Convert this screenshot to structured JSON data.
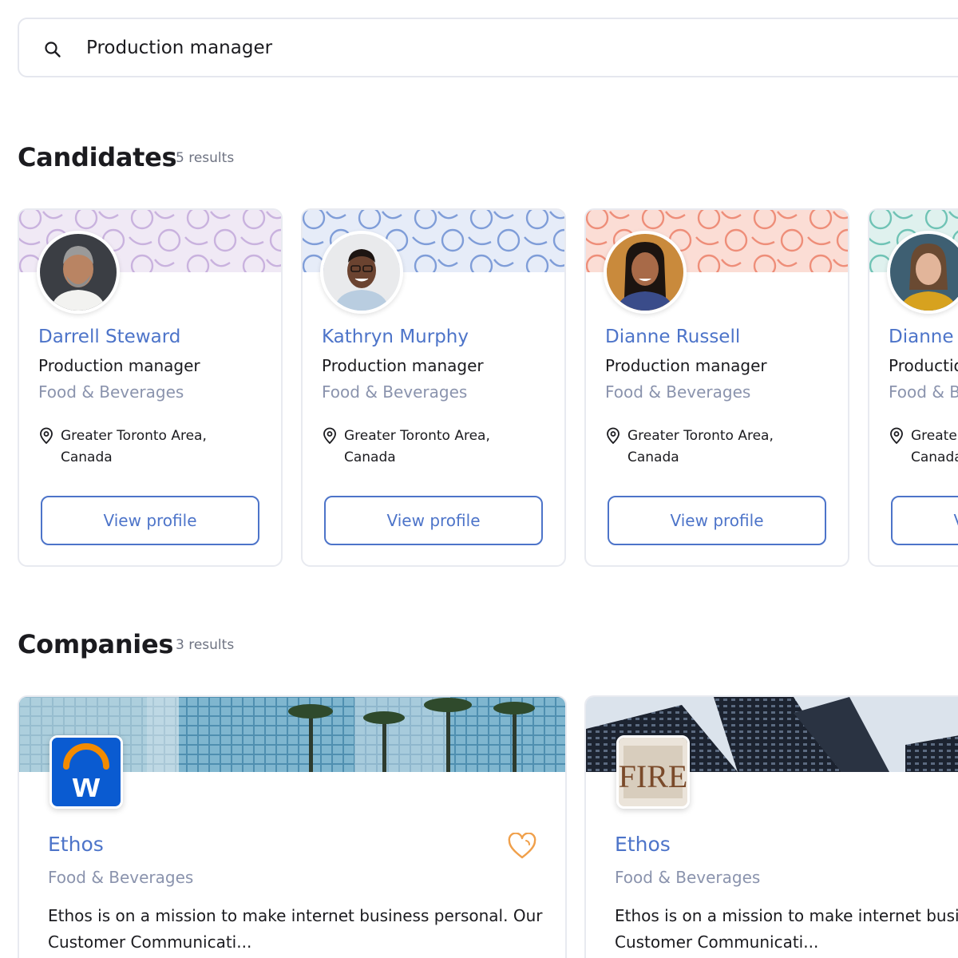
{
  "search": {
    "value": "Production manager",
    "icon": "search-icon"
  },
  "candidates": {
    "title": "Candidates",
    "count": "5 results",
    "items": [
      {
        "name": "Darrell Steward",
        "title": "Production manager",
        "industry": "Food & Beverages",
        "location": "Greater Toronto Area, Canada",
        "button": "View profile",
        "banner_bg": "#f0e9f5",
        "banner_stroke": "#c9b2de"
      },
      {
        "name": "Kathryn Murphy",
        "title": "Production manager",
        "industry": "Food & Beverages",
        "location": "Greater Toronto Area, Canada",
        "button": "View profile",
        "banner_bg": "#e6ecf8",
        "banner_stroke": "#7f9dd8"
      },
      {
        "name": "Dianne Russell",
        "title": "Production manager",
        "industry": "Food & Beverages",
        "location": "Greater Toronto Area, Canada",
        "button": "View profile",
        "banner_bg": "#fbddd5",
        "banner_stroke": "#ee8e79"
      },
      {
        "name": "Dianne Russell",
        "title": "Production manager",
        "industry": "Food & Beverages",
        "location": "Greater Toronto Area, Canada",
        "button": "View profile",
        "banner_bg": "#dff1ee",
        "banner_stroke": "#6fc3b5"
      }
    ]
  },
  "companies": {
    "title": "Companies",
    "count": "3 results",
    "items": [
      {
        "name": "Ethos",
        "industry": "Food & Beverages",
        "description": "Ethos is on a mission to make internet business personal. Our Customer Communicati...",
        "logo_text": "w",
        "heart_icon": "heart-icon"
      },
      {
        "name": "Ethos",
        "industry": "Food & Beverages",
        "description": "Ethos is on a mission to make internet business personal. Our Customer Communicati...",
        "logo_text": "FIRE"
      }
    ]
  },
  "colors": {
    "accent": "#4d74c9",
    "muted": "#8a93ad",
    "heart": "#f0a04b",
    "workday_blue": "#0a5bd1",
    "workday_orange": "#f38b00"
  }
}
